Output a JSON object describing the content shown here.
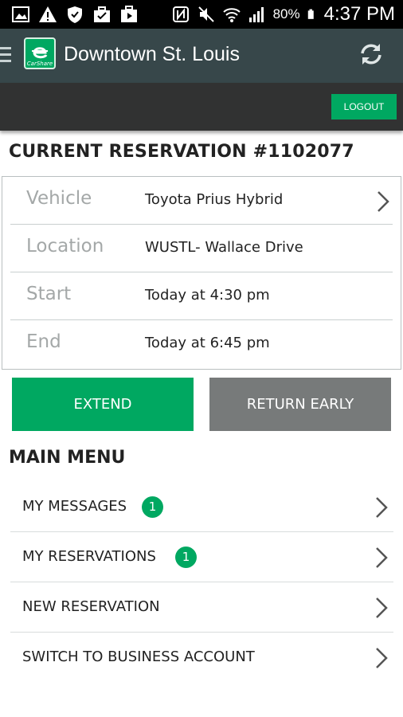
{
  "status_bar": {
    "battery_pct": "80%",
    "time": "4:37 PM",
    "icons": [
      "image-icon",
      "warning-icon",
      "shield-icon",
      "briefcase-check-icon",
      "play-store-icon",
      "nfc-icon",
      "mute-icon",
      "wifi-icon",
      "signal-icon",
      "battery-icon"
    ]
  },
  "app_bar": {
    "logo_text": "CarShare",
    "title": "Downtown St. Louis",
    "icons": [
      "menu-icon",
      "refresh-icon"
    ]
  },
  "sub_bar": {
    "logout_label": "LOGOUT"
  },
  "reservation": {
    "heading": "CURRENT RESERVATION #1102077",
    "rows": [
      {
        "label": "Vehicle",
        "value": "Toyota Prius Hybrid"
      },
      {
        "label": "Location",
        "value": "WUSTL- Wallace Drive"
      },
      {
        "label": "Start",
        "value": "Today at 4:30 pm"
      },
      {
        "label": "End",
        "value": "Today at 6:45 pm"
      }
    ]
  },
  "actions": {
    "extend_label": "EXTEND",
    "return_label": "RETURN EARLY"
  },
  "main_menu": {
    "heading": "MAIN MENU",
    "items": [
      {
        "label": "MY MESSAGES",
        "badge": "1"
      },
      {
        "label": "MY RESERVATIONS",
        "badge": "1"
      },
      {
        "label": "NEW RESERVATION"
      },
      {
        "label": "SWITCH TO BUSINESS ACCOUNT"
      }
    ]
  },
  "colors": {
    "accent": "#00a861",
    "app_bar": "#37474a",
    "sub_bar": "#313232",
    "secondary_button": "#777a7a"
  }
}
